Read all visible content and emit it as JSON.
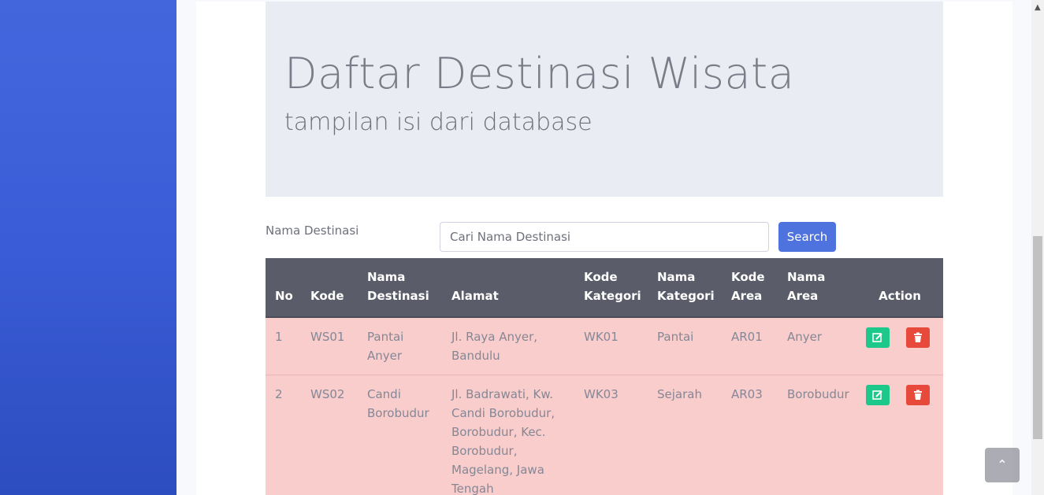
{
  "header": {
    "title": "Daftar Destinasi Wisata",
    "subtitle": "tampilan isi dari database"
  },
  "search": {
    "label": "Nama Destinasi",
    "placeholder": "Cari Nama Destinasi",
    "button_label": "Search"
  },
  "table": {
    "columns": [
      "No",
      "Kode",
      "Nama Destinasi",
      "Alamat",
      "Kode Kategori",
      "Nama Kategori",
      "Kode Area",
      "Nama Area",
      "Action"
    ],
    "rows": [
      {
        "no": "1",
        "kode": "WS01",
        "nama": "Pantai Anyer",
        "alamat": "Jl. Raya Anyer, Bandulu",
        "kode_kategori": "WK01",
        "nama_kategori": "Pantai",
        "kode_area": "AR01",
        "nama_area": "Anyer"
      },
      {
        "no": "2",
        "kode": "WS02",
        "nama": "Candi Borobudur",
        "alamat": "Jl. Badrawati, Kw. Candi Borobudur, Borobudur, Kec. Borobudur, Magelang, Jawa Tengah",
        "kode_kategori": "WK03",
        "nama_kategori": "Sejarah",
        "kode_area": "AR03",
        "nama_area": "Borobudur"
      }
    ]
  },
  "icons": {
    "edit": "edit-icon",
    "delete": "trash-icon",
    "scroll_top": "chevron-up-icon"
  },
  "colors": {
    "sidebar": "#3a5cd6",
    "primary": "#4e73df",
    "success": "#1cc88a",
    "danger": "#e74a3b",
    "table_header": "#5a5c69",
    "row_bg": "#f8cdcb"
  }
}
